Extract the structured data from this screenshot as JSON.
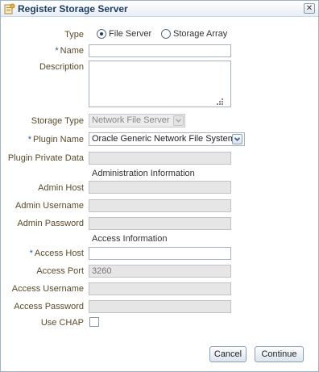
{
  "dialog": {
    "title": "Register Storage Server",
    "title_icon": "storage-server-icon",
    "close_icon": "close-icon",
    "close_glyph": "✕"
  },
  "form": {
    "type": {
      "label": "Type",
      "options": [
        {
          "label": "File Server",
          "selected": true
        },
        {
          "label": "Storage Array",
          "selected": false
        }
      ]
    },
    "name": {
      "label": "Name",
      "required_mark": "*",
      "value": ""
    },
    "description": {
      "label": "Description",
      "value": ""
    },
    "storage_type": {
      "label": "Storage Type",
      "value": "Network File Server"
    },
    "plugin_name": {
      "label": "Plugin Name",
      "required_mark": "*",
      "value": "Oracle Generic Network File System"
    },
    "plugin_private_data": {
      "label": "Plugin Private Data",
      "value": ""
    },
    "admin_section": {
      "header": "Administration Information",
      "admin_host": {
        "label": "Admin Host",
        "value": ""
      },
      "admin_username": {
        "label": "Admin Username",
        "value": ""
      },
      "admin_password": {
        "label": "Admin Password",
        "value": ""
      }
    },
    "access_section": {
      "header": "Access Information",
      "access_host": {
        "label": "Access Host",
        "required_mark": "*",
        "value": ""
      },
      "access_port": {
        "label": "Access Port",
        "value": "3260"
      },
      "access_username": {
        "label": "Access Username",
        "value": ""
      },
      "access_password": {
        "label": "Access Password",
        "value": ""
      },
      "use_chap": {
        "label": "Use CHAP",
        "checked": false
      }
    }
  },
  "buttons": {
    "cancel": "Cancel",
    "continue": "Continue"
  },
  "colors": {
    "title_text": "#1f3f68",
    "label_text": "#5a4a2a",
    "required_mark": "#1f5fad",
    "disabled_field": "#e6e6e6"
  }
}
